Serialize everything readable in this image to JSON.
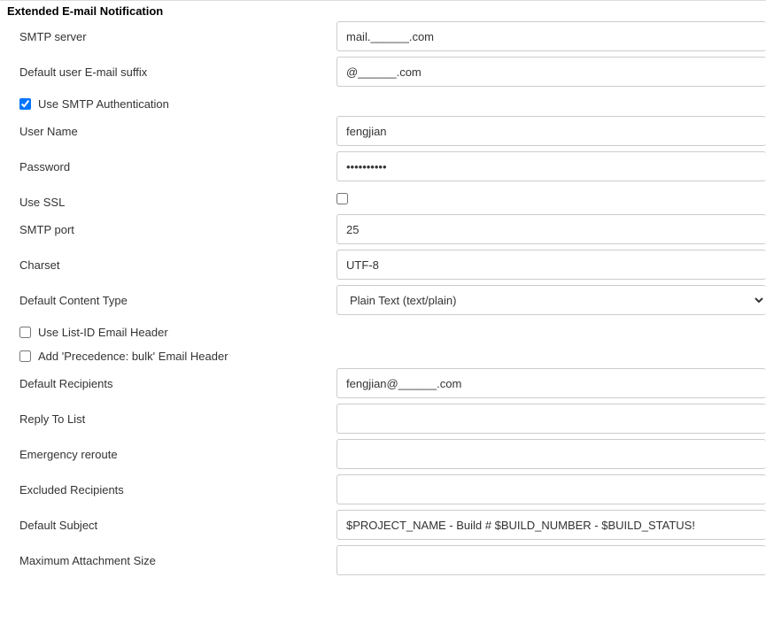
{
  "section": {
    "title": "Extended E-mail Notification"
  },
  "fields": {
    "smtp_server": {
      "label": "SMTP server",
      "value": "mail.______.com"
    },
    "default_suffix": {
      "label": "Default user E-mail suffix",
      "value": "@______.com"
    },
    "use_smtp_auth": {
      "label": "Use SMTP Authentication",
      "checked": true
    },
    "username": {
      "label": "User Name",
      "value": "fengjian"
    },
    "password": {
      "label": "Password",
      "value": "••••••••••"
    },
    "use_ssl": {
      "label": "Use SSL",
      "checked": false
    },
    "smtp_port": {
      "label": "SMTP port",
      "value": "25"
    },
    "charset": {
      "label": "Charset",
      "value": "UTF-8"
    },
    "content_type": {
      "label": "Default Content Type",
      "value": "Plain Text (text/plain)"
    },
    "use_list_id": {
      "label": "Use List-ID Email Header",
      "checked": false
    },
    "precedence_bulk": {
      "label": "Add 'Precedence: bulk' Email Header",
      "checked": false
    },
    "default_recipients": {
      "label": "Default Recipients",
      "value": "fengjian@______.com"
    },
    "reply_to": {
      "label": "Reply To List",
      "value": ""
    },
    "emergency_reroute": {
      "label": "Emergency reroute",
      "value": ""
    },
    "excluded_recipients": {
      "label": "Excluded Recipients",
      "value": ""
    },
    "default_subject": {
      "label": "Default Subject",
      "value": "$PROJECT_NAME - Build # $BUILD_NUMBER - $BUILD_STATUS!"
    },
    "max_attachment": {
      "label": "Maximum Attachment Size",
      "value": ""
    }
  }
}
